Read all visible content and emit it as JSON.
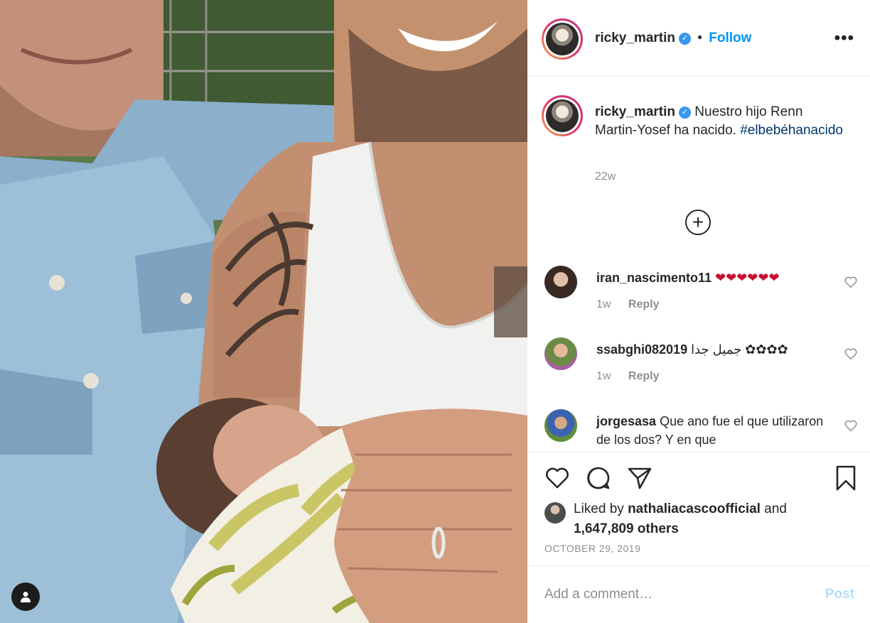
{
  "post": {
    "author": "ricky_martin",
    "follow_label": "Follow",
    "separator": "•",
    "more_label": "•••",
    "caption_text": "Nuestro hijo Renn Martin-Yosef ha nacido.",
    "hashtag": "#elbebéhanacido",
    "caption_time": "22w",
    "load_more_label": "+"
  },
  "comments": [
    {
      "user": "iran_nascimento11",
      "text": "❤❤❤❤❤❤",
      "time": "1w",
      "reply_label": "Reply"
    },
    {
      "user": "ssabghi082019",
      "text": "جميل جدا ✿✿✿✿",
      "time": "1w",
      "reply_label": "Reply"
    },
    {
      "user": "jorgesasa",
      "text": "Que ano fue el que utilizaron de los dos? Y en que"
    }
  ],
  "likes": {
    "prefix": "Liked by",
    "liker": "nathaliacascoofficial",
    "and": "and",
    "count": "1,647,809 others"
  },
  "date": "OCTOBER 29, 2019",
  "add_comment": {
    "placeholder": "Add a comment…",
    "post_label": "Post"
  },
  "icons": {
    "like": "heart-icon",
    "comment": "comment-icon",
    "share": "paper-plane-icon",
    "save": "bookmark-icon",
    "tag": "user-tag-icon",
    "verified": "verified-badge-icon"
  },
  "colors": {
    "link_blue": "#0095f6",
    "verified_blue": "#3897f0",
    "hashtag": "#00376b",
    "meta_gray": "#8e8e8e",
    "post_disabled": "#b2dffc"
  }
}
